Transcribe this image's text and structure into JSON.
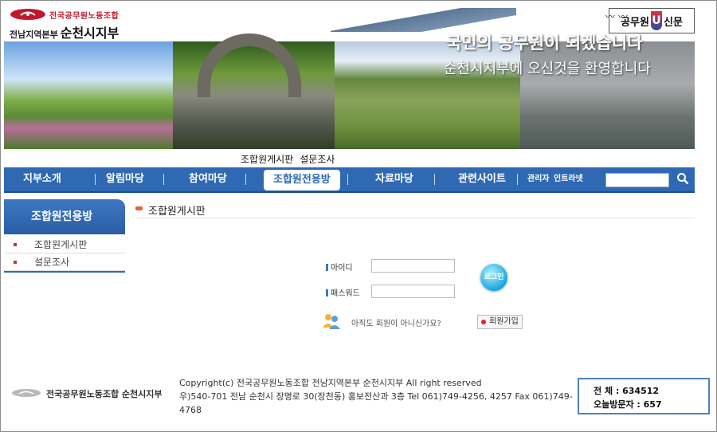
{
  "header": {
    "logo_union": "전국공무원노동조합",
    "logo_branch": "전남지역본부",
    "logo_sub_branch": "순천시지부",
    "newspaper_left": "공무원",
    "newspaper_mark": "U",
    "newspaper_right": "신문"
  },
  "banner": {
    "slogan_line1": "국민의 공무원이 되겠습니다",
    "slogan_line2": "순천시지부에 오신것을 환영합니다"
  },
  "breadcrumb": [
    "조합원게시판",
    "설문조사"
  ],
  "nav": {
    "items": [
      "지부소개",
      "알림마당",
      "참여마당",
      "조합원전용방",
      "자료마당",
      "관련사이트"
    ],
    "active_index": 3,
    "admin": "관리자",
    "intranet": "인트라넷",
    "search_value": ""
  },
  "sidebar": {
    "title": "조합원전용방",
    "items": [
      "조합원게시판",
      "설문조사"
    ]
  },
  "main": {
    "title": "조합원게시판"
  },
  "login": {
    "id_label": "아이디",
    "pw_label": "패스워드",
    "id_value": "",
    "pw_value": "",
    "login_button": "로그인",
    "not_member": "아직도 회원이 아니신가요?",
    "join_button": "회원가입"
  },
  "footer": {
    "logo_text": "전국공무원노동조합 순천시지부",
    "copyright": "Copyright(c) 전국공무원노동조합 전남지역본부 순천시지부 All right reserved",
    "address": "우)540-701 전남 순천시 장명로 30(장천동) 홍보전산과 3층 Tel 061)749-4256, 4257 Fax 061)749-4768",
    "total_label": "전 체 : 634512",
    "today_label": "오늘방문자 : 657"
  },
  "colors": {
    "nav_blue": "#2f69b4",
    "brand_red": "#c0192b",
    "accent_orange": "#e8603c"
  }
}
